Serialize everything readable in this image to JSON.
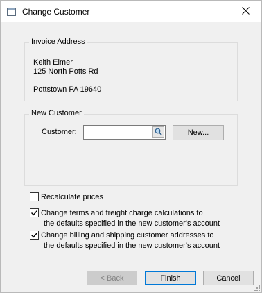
{
  "window": {
    "title": "Change Customer",
    "close_glyph": "✕"
  },
  "invoice_address": {
    "group_label": "Invoice Address",
    "name": "Keith Elmer",
    "street": "125 North Potts Rd",
    "city_line": "Pottstown PA  19640"
  },
  "new_customer": {
    "group_label": "New Customer",
    "customer_label": "Customer:",
    "customer_value": "",
    "new_button_label": "New..."
  },
  "options": {
    "recalculate": {
      "label": "Recalculate prices",
      "checked": false
    },
    "change_terms": {
      "label_line1": "Change terms and freight charge calculations to",
      "label_line2": "the defaults specified in the new customer's account",
      "checked": true
    },
    "change_addresses": {
      "label_line1": "Change billing and shipping customer addresses to",
      "label_line2": "the defaults specified in the new customer's account",
      "checked": true
    }
  },
  "buttons": {
    "back": "< Back",
    "finish": "Finish",
    "cancel": "Cancel"
  },
  "colors": {
    "accent": "#0078d7",
    "dialog_bg": "#f0f0f0"
  }
}
